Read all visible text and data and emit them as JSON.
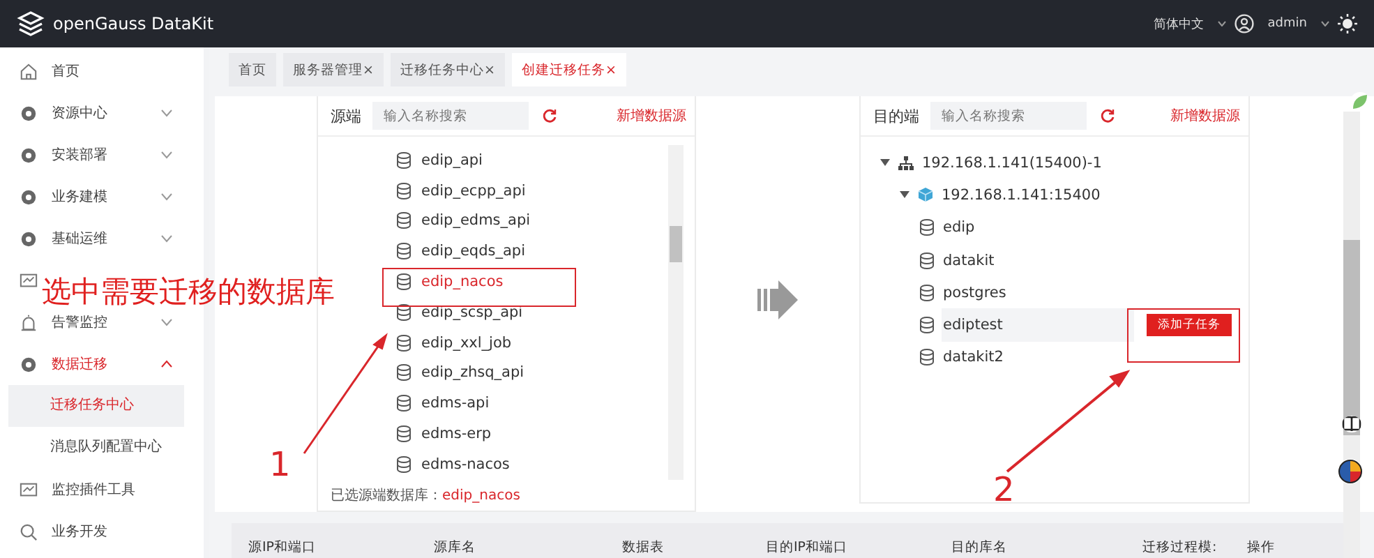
{
  "header": {
    "title": "openGauss DataKit",
    "language": "简体中文",
    "user": "admin"
  },
  "sidebar": {
    "items": [
      {
        "label": "首页",
        "kind": "home"
      },
      {
        "label": "资源中心",
        "kind": "gear",
        "expanded": false
      },
      {
        "label": "安装部署",
        "kind": "gear",
        "expanded": false
      },
      {
        "label": "业务建模",
        "kind": "gear",
        "expanded": false
      },
      {
        "label": "基础运维",
        "kind": "gear",
        "expanded": false
      },
      {
        "kind": "monitor"
      },
      {
        "label": "告警监控",
        "kind": "alarm",
        "expanded": false
      },
      {
        "label": "数据迁移",
        "kind": "gear",
        "expanded": true,
        "children": [
          {
            "label": "迁移任务中心",
            "selected": true
          },
          {
            "label": "消息队列配置中心",
            "selected": false
          }
        ]
      },
      {
        "label": "监控插件工具",
        "kind": "monitor"
      },
      {
        "label": "业务开发",
        "kind": "search"
      }
    ]
  },
  "tabs": [
    {
      "label": "首页",
      "selected": false
    },
    {
      "label": "服务器管理",
      "close": "×",
      "selected": false
    },
    {
      "label": "迁移任务中心",
      "close": "×",
      "selected": false
    },
    {
      "label": "创建迁移任务",
      "close": "×",
      "selected": true
    }
  ],
  "source": {
    "title": "源端",
    "placeholder": "输入名称搜索",
    "add": "新增数据源",
    "databases": [
      {
        "name": "edip_api",
        "selected": false
      },
      {
        "name": "edip_ecpp_api",
        "selected": false
      },
      {
        "name": "edip_edms_api",
        "selected": false
      },
      {
        "name": "edip_eqds_api",
        "selected": false
      },
      {
        "name": "edip_nacos",
        "selected": true
      },
      {
        "name": "edip_scsp_api",
        "selected": false
      },
      {
        "name": "edip_xxl_job",
        "selected": false
      },
      {
        "name": "edip_zhsq_api",
        "selected": false
      },
      {
        "name": "edms-api",
        "selected": false
      },
      {
        "name": "edms-erp",
        "selected": false
      },
      {
        "name": "edms-nacos",
        "selected": false
      }
    ],
    "selected_label": "已选源端数据库：",
    "selected_value": "edip_nacos"
  },
  "target": {
    "title": "目的端",
    "placeholder": "输入名称搜索",
    "add": "新增数据源",
    "action": "添加子任务",
    "tree": [
      {
        "label": "192.168.1.141(15400)-1",
        "kind": "cluster",
        "expanded": true,
        "children": [
          {
            "label": "192.168.1.141:15400",
            "kind": "instance",
            "expanded": true,
            "children": [
              {
                "label": "edip",
                "kind": "database",
                "selected": false
              },
              {
                "label": "datakit",
                "kind": "database",
                "selected": false
              },
              {
                "label": "postgres",
                "kind": "database",
                "selected": false
              },
              {
                "label": "ediptest",
                "kind": "database",
                "selected": true
              },
              {
                "label": "datakit2",
                "kind": "database",
                "selected": false
              }
            ]
          }
        ]
      }
    ]
  },
  "table": {
    "columns": [
      "源IP和端口",
      "源库名",
      "数据表",
      "目的IP和端口",
      "目的库名",
      "迁移过程模:",
      "操作"
    ]
  },
  "annotations": {
    "instruction": "选中需要迁移的数据库",
    "steps": [
      "1",
      "2"
    ]
  }
}
